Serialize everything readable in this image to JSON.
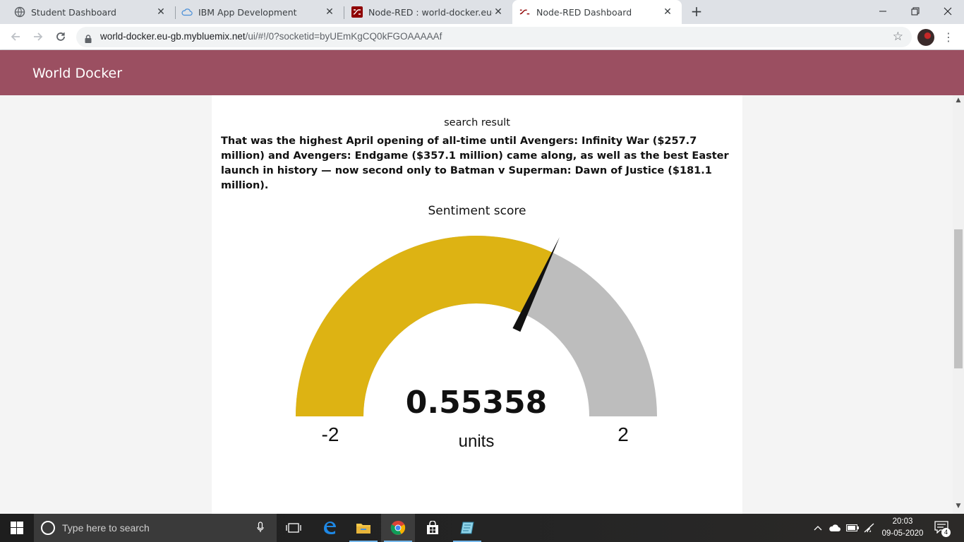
{
  "browser": {
    "tabs": [
      {
        "title": "Student Dashboard",
        "icon": "globe-icon"
      },
      {
        "title": "IBM App Development",
        "icon": "cloud-icon"
      },
      {
        "title": "Node-RED : world-docker.eu-gb.mybluemix.net",
        "icon": "node-red-icon"
      },
      {
        "title": "Node-RED Dashboard",
        "icon": "node-red-icon",
        "active": true
      }
    ],
    "url_host": "world-docker.eu-gb.mybluemix.net",
    "url_path": "/ui/#!/0?socketid=byUEmKgCQ0kFGOAAAAAf"
  },
  "dashboard": {
    "title": "World Docker",
    "header_color": "#9b4f61",
    "result_label": "search result",
    "result_text": "That was the highest April opening of all-time until Avengers: Infinity War ($257.7 million) and Avengers: Endgame ($357.1 million) came along, as well as the best Easter launch in history — now second only to Batman v Superman: Dawn of Justice ($181.1 million).",
    "gauge": {
      "title": "Sentiment score",
      "value": 0.55358,
      "value_text": "0.55358",
      "units": "units",
      "min": -2,
      "max": 2,
      "min_label": "-2",
      "max_label": "2",
      "fill_color": "#ddb313",
      "track_color": "#bdbdbd",
      "needle_color": "#111111"
    }
  },
  "taskbar": {
    "search_placeholder": "Type here to search",
    "time": "20:03",
    "date": "09-05-2020",
    "notification_count": "4"
  }
}
